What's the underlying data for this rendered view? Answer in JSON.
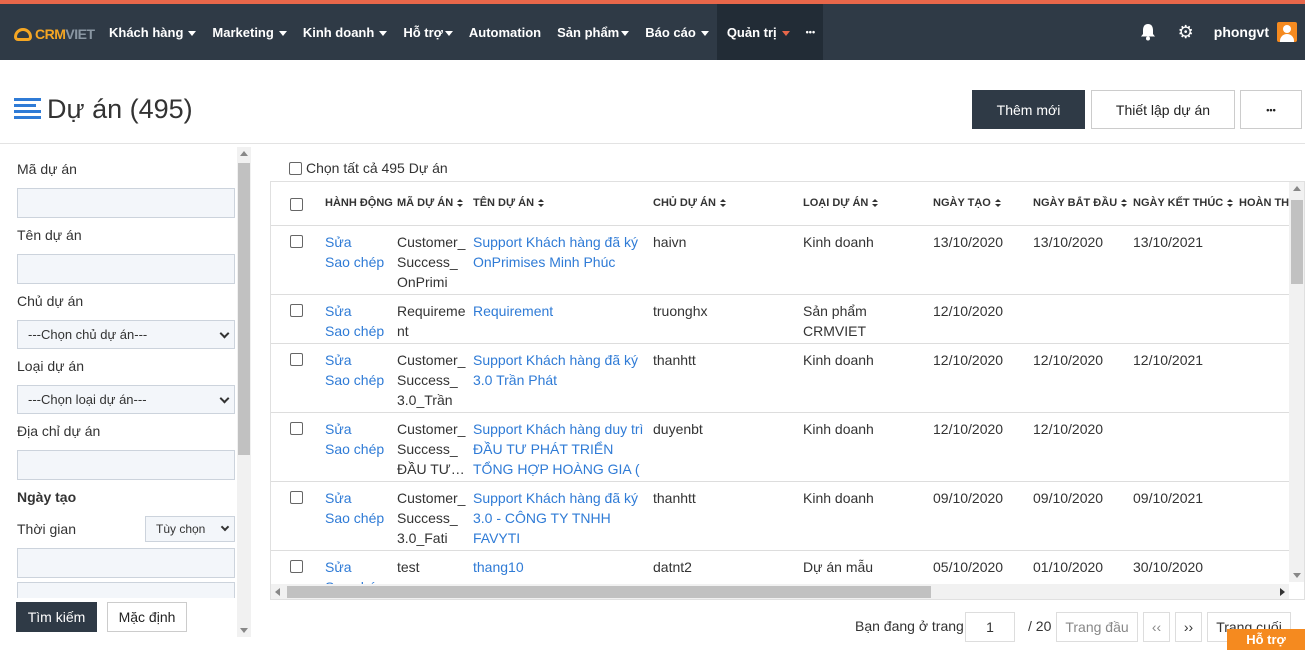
{
  "app": {
    "logo_main": "CRM",
    "logo_accent": "VIET",
    "brand_color": "#f5a623",
    "nav_bg": "#2f3a46",
    "link_color": "#2f7bd6"
  },
  "nav": {
    "items": [
      {
        "label": "Khách hàng",
        "dropdown": true
      },
      {
        "label": "Marketing",
        "dropdown": true
      },
      {
        "label": "Kinh doanh",
        "dropdown": true
      },
      {
        "label": "Hỗ trợ",
        "dropdown": true
      },
      {
        "label": "Automation",
        "dropdown": false
      },
      {
        "label": "Sản phẩm",
        "dropdown": true
      },
      {
        "label": "Báo cáo",
        "dropdown": true
      },
      {
        "label": "Quản trị",
        "dropdown": true,
        "active": true
      },
      {
        "label": "•••",
        "dropdown": false
      }
    ],
    "username": "phongvt",
    "icons": [
      "bell-icon",
      "gear-icon",
      "user-avatar-icon"
    ]
  },
  "header": {
    "title": "Dự án (495)",
    "add_label": "Thêm mới",
    "setup_label": "Thiết lập dự án",
    "more_label": "•••"
  },
  "filters": {
    "code_label": "Mã dự án",
    "name_label": "Tên dự án",
    "owner_label": "Chủ dự án",
    "owner_value": "---Chọn chủ dự án---",
    "type_label": "Loại dự án",
    "type_value": "---Chọn loại dự án---",
    "address_label": "Địa chỉ dự án",
    "created_label": "Ngày tạo",
    "time_label": "Thời gian",
    "time_value": "Tùy chọn",
    "search_label": "Tìm kiếm",
    "default_label": "Mặc định"
  },
  "table": {
    "select_all": "Chọn tất cả 495 Dự án",
    "columns": [
      "HÀNH ĐỘNG",
      "MÃ DỰ ÁN",
      "TÊN DỰ ÁN",
      "CHỦ DỰ ÁN",
      "LOẠI DỰ ÁN",
      "NGÀY TẠO",
      "NGÀY BẮT ĐẦU",
      "NGÀY KẾT THÚC",
      "HOÀN THÀ"
    ],
    "edit_label": "Sửa",
    "copy_label": "Sao chép",
    "rows": [
      {
        "code": "Customer_Success_OnPrimis…",
        "name": "Support Khách hàng đã ký OnPrimises Minh Phúc",
        "owner": "haivn",
        "type": "Kinh doanh",
        "created": "13/10/2020",
        "start": "13/10/2020",
        "end": "13/10/2021"
      },
      {
        "code": "Requirement",
        "name": "Requirement",
        "owner": "truonghx",
        "type": "Sản phẩm CRMVIET",
        "created": "12/10/2020",
        "start": "",
        "end": ""
      },
      {
        "code": "Customer_Success_3.0_Trần_…",
        "name": "Support Khách hàng đã ký 3.0 Trần Phát",
        "owner": "thanhtt",
        "type": "Kinh doanh",
        "created": "12/10/2020",
        "start": "12/10/2020",
        "end": "12/10/2021"
      },
      {
        "code": "Customer_Success_ĐẦU TƯ…",
        "name": "Support Khách hàng duy trì ĐẦU TƯ PHÁT TRIỂN TỔNG HỢP HOÀNG GIA ( ANDY…",
        "owner": "duyenbt",
        "type": "Kinh doanh",
        "created": "12/10/2020",
        "start": "12/10/2020",
        "end": ""
      },
      {
        "code": "Customer_Success_3.0_Fati",
        "name": "Support Khách hàng đã ký 3.0 - CÔNG TY TNHH FAVYTI",
        "owner": "thanhtt",
        "type": "Kinh doanh",
        "created": "09/10/2020",
        "start": "09/10/2020",
        "end": "09/10/2021"
      },
      {
        "code": "test",
        "name": "thang10",
        "owner": "datnt2",
        "type": "Dự án mẫu",
        "created": "05/10/2020",
        "start": "01/10/2020",
        "end": "30/10/2020"
      }
    ]
  },
  "pager": {
    "prefix": "Bạn đang ở trang",
    "current": "1",
    "total": "/ 20",
    "first": "Trang đầu",
    "prev": "‹‹",
    "next": "››",
    "last": "Trang cuối"
  },
  "help": {
    "label": "Hỗ trợ"
  }
}
